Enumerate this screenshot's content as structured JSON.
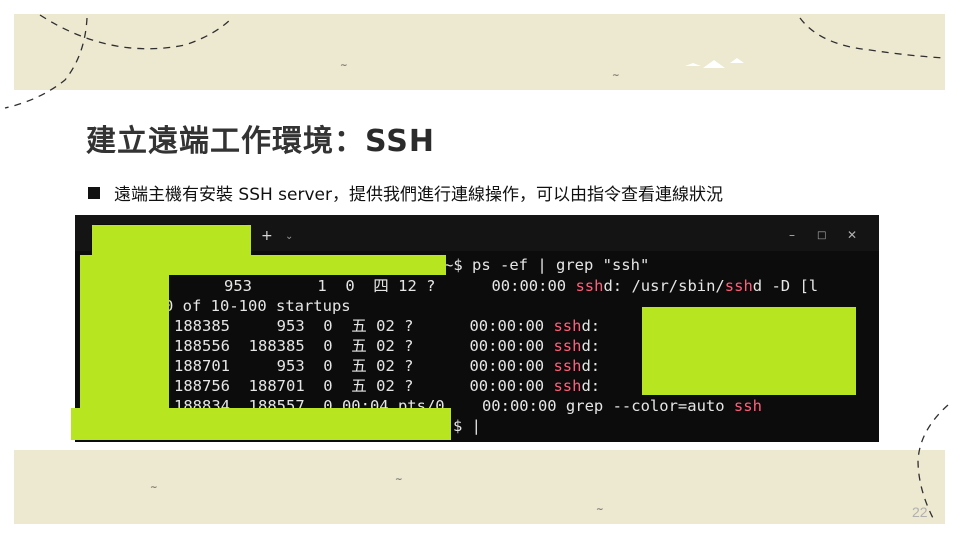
{
  "slide": {
    "title_main": "建立遠端工作環境：",
    "title_accent": "SSH",
    "bullet": "遠端主機有安裝 SSH server，提供我們進行連線操作，可以由指令查看連線狀況",
    "page_number": "22",
    "colors": {
      "band": "#ede8d0",
      "redaction": "#b7e51f",
      "terminal_bg": "#0c0c0c",
      "highlight": "#ff5f7a"
    }
  },
  "terminal": {
    "tab_add": "+",
    "tab_dropdown": "⌄",
    "window_controls": {
      "minimize": "–",
      "maximize": "□",
      "close": "✕"
    },
    "prompt_tail": "~$ ps -ef | grep \"ssh\"",
    "rows": [
      {
        "pre": "953       1  0  四 12 ?      00:00:00 ",
        "hl1": "ssh",
        "mid": "d: /usr/sbin/",
        "hl2": "ssh",
        "post": "d -D [l"
      },
      {
        "pre": "0 of 10-100 startups"
      },
      {
        "pre": "188385     953  0  五 02 ?      00:00:00 ",
        "hl1": "ssh",
        "mid": "d:"
      },
      {
        "pre": "188556  188385  0  五 02 ?      00:00:00 ",
        "hl1": "ssh",
        "mid": "d:"
      },
      {
        "pre": "188701     953  0  五 02 ?      00:00:00 ",
        "hl1": "ssh",
        "mid": "d:"
      },
      {
        "pre": "188756  188701  0  五 02 ?      00:00:00 ",
        "hl1": "ssh",
        "mid": "d:"
      },
      {
        "pre": "188834  188557  0 00:04 pts/0    00:00:00 grep --color=auto ",
        "hl1": "ssh"
      }
    ],
    "last_prompt": "$ |"
  }
}
